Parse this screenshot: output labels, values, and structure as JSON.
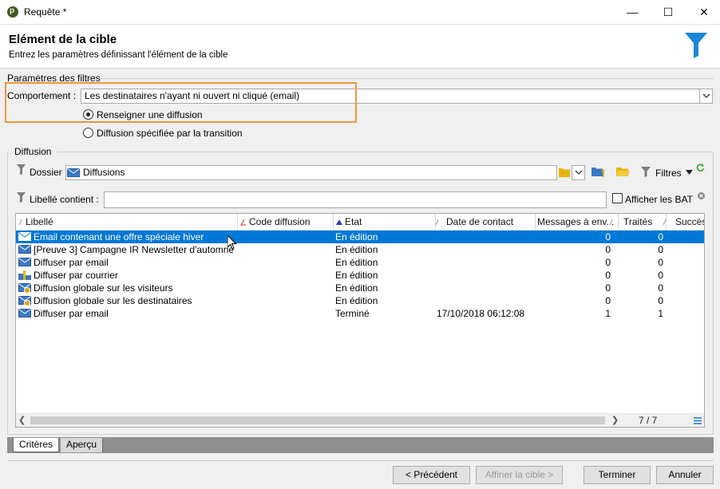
{
  "window": {
    "title": "Requête *",
    "icon_letter": "p",
    "controls": {
      "minimize": "—",
      "maximize": "☐",
      "close": "✕"
    }
  },
  "header": {
    "title": "Elément de la cible",
    "subtitle": "Entrez les paramètres définissant l'élément de la cible"
  },
  "filters": {
    "group_label": "Paramètres des filtres",
    "behavior_label": "Comportement :",
    "behavior_value": "Les destinataires n'ayant ni ouvert ni cliqué (email)",
    "radio1_label": "Renseigner une diffusion",
    "radio2_label": "Diffusion spécifiée par la transition",
    "radio_selected": 1
  },
  "diffusion": {
    "group_label": "Diffusion",
    "folder_label": "Dossier :",
    "folder_value": "Diffusions",
    "filters_label": "Filtres",
    "label_contains": "Libellé contient :",
    "label_contains_value": "",
    "show_bat_label": "Afficher les BAT",
    "show_bat_checked": false
  },
  "table": {
    "columns": [
      "Libellé",
      "Code diffusion",
      "Etat",
      "Date de contact",
      "Messages à env...",
      "Traités",
      "Succès"
    ],
    "rows": [
      {
        "label": "Email contenant une offre spéciale hiver",
        "icon": "email-icon",
        "code": "",
        "status": "En édition",
        "date": "",
        "msgs": "0",
        "processed": "0",
        "selected": true
      },
      {
        "label": "[Preuve 3] Campagne IR Newsletter d'automne",
        "icon": "email-icon",
        "code": "",
        "status": "En édition",
        "date": "",
        "msgs": "0",
        "processed": "0"
      },
      {
        "label": "Diffuser par email",
        "icon": "email-icon",
        "code": "",
        "status": "En édition",
        "date": "",
        "msgs": "0",
        "processed": "0"
      },
      {
        "label": "Diffuser par courrier",
        "icon": "mail-courier-icon",
        "code": "",
        "status": "En édition",
        "date": "",
        "msgs": "0",
        "processed": "0"
      },
      {
        "label": "Diffusion globale sur les visiteurs",
        "icon": "global-email-icon",
        "code": "",
        "status": "En édition",
        "date": "",
        "msgs": "0",
        "processed": "0"
      },
      {
        "label": "Diffusion globale sur les destinataires",
        "icon": "global-email-icon",
        "code": "",
        "status": "En édition",
        "date": "",
        "msgs": "0",
        "processed": "0"
      },
      {
        "label": "Diffuser par email",
        "icon": "email-icon",
        "code": "",
        "status": "Terminé",
        "date": "17/10/2018 06:12:08",
        "msgs": "1",
        "processed": "1"
      }
    ],
    "count": "7 / 7"
  },
  "tabs": [
    "Critères",
    "Aperçu"
  ],
  "active_tab": 0,
  "buttons": {
    "previous": "< Précédent",
    "refine": "Affiner la cible >",
    "finish": "Terminer",
    "cancel": "Annuler"
  },
  "colors": {
    "selection": "#0078d7",
    "highlight": "#f0953c",
    "funnel": "#1a86d8"
  }
}
